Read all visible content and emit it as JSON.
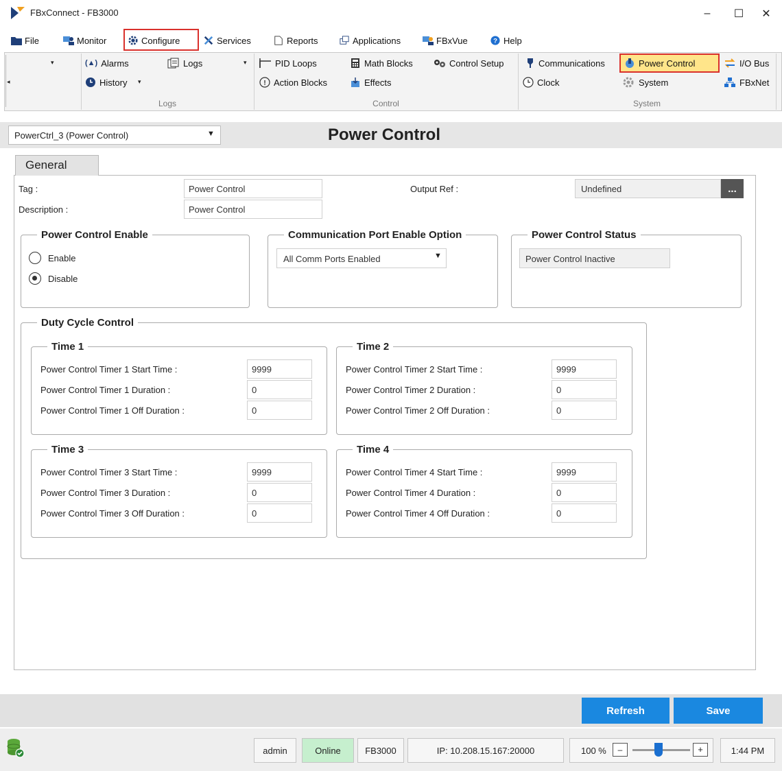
{
  "window": {
    "title": "FBxConnect - FB3000",
    "minimize": "–",
    "maximize": "☐",
    "close": "✕"
  },
  "menu": {
    "file": "File",
    "monitor": "Monitor",
    "configure": "Configure",
    "services": "Services",
    "reports": "Reports",
    "applications": "Applications",
    "fbxvue": "FBxVue",
    "help": "Help"
  },
  "ribbon": {
    "alarms": "Alarms",
    "history": "History",
    "logs": "Logs",
    "logs_group": "Logs",
    "pid_loops": "PID Loops",
    "action_blocks": "Action Blocks",
    "math_blocks": "Math Blocks",
    "effects": "Effects",
    "control_setup": "Control Setup",
    "control_group": "Control",
    "communications": "Communications",
    "clock": "Clock",
    "power_control": "Power Control",
    "system": "System",
    "io_bus": "I/O Bus",
    "fbxnet": "FBxNet",
    "system_group": "System"
  },
  "header": {
    "selected_point": "PowerCtrl_3 (Power Control)",
    "page_title": "Power Control"
  },
  "tabs": {
    "general": "General"
  },
  "general": {
    "tag_label": "Tag :",
    "tag_value": "Power Control",
    "description_label": "Description :",
    "description_value": "Power Control",
    "output_ref_label": "Output Ref :",
    "output_ref_value": "Undefined",
    "browse": "..."
  },
  "enable_group": {
    "title": "Power Control Enable",
    "enable": "Enable",
    "disable": "Disable",
    "selected": "Disable"
  },
  "comm_group": {
    "title": "Communication Port Enable Option",
    "selected": "All Comm Ports Enabled"
  },
  "status_group": {
    "title": "Power Control Status",
    "value": "Power Control Inactive"
  },
  "duty_cycle": {
    "title": "Duty Cycle Control",
    "time1": {
      "title": "Time 1",
      "start_label": "Power Control Timer 1 Start Time :",
      "start": "9999",
      "dur_label": "Power Control Timer 1 Duration :",
      "dur": "0",
      "off_label": "Power Control Timer 1 Off Duration :",
      "off": "0"
    },
    "time2": {
      "title": "Time 2",
      "start_label": "Power Control Timer 2 Start Time :",
      "start": "9999",
      "dur_label": "Power Control Timer 2 Duration :",
      "dur": "0",
      "off_label": "Power Control Timer 2 Off Duration :",
      "off": "0"
    },
    "time3": {
      "title": "Time 3",
      "start_label": "Power Control Timer 3 Start Time :",
      "start": "9999",
      "dur_label": "Power Control Timer 3 Duration :",
      "dur": "0",
      "off_label": "Power Control Timer 3 Off Duration :",
      "off": "0"
    },
    "time4": {
      "title": "Time 4",
      "start_label": "Power Control Timer 4 Start Time :",
      "start": "9999",
      "dur_label": "Power Control Timer 4 Duration :",
      "dur": "0",
      "off_label": "Power Control Timer 4 Off Duration :",
      "off": "0"
    }
  },
  "buttons": {
    "refresh": "Refresh",
    "save": "Save"
  },
  "status": {
    "user": "admin",
    "connection": "Online",
    "device": "FB3000",
    "ip": "IP: 10.208.15.167:20000",
    "zoom": "100 %",
    "zoom_minus": "–",
    "zoom_plus": "+",
    "zoom_level": 0.45,
    "time": "1:44 PM"
  },
  "colors": {
    "accent": "#1a88e0",
    "highlight_border": "#d9302b",
    "highlight_fill": "#ffe58a",
    "online": "#c6efce"
  }
}
